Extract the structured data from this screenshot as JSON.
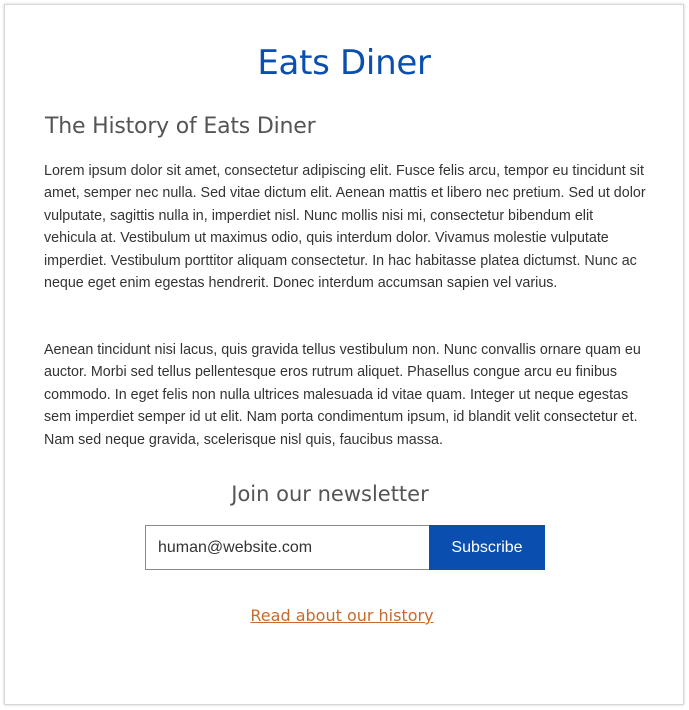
{
  "site": {
    "title": "Eats Diner",
    "brand_color": "#0a4fb0"
  },
  "history": {
    "heading": "The History of Eats Diner",
    "paragraphs": [
      "Lorem ipsum dolor sit amet, consectetur adipiscing elit. Fusce felis arcu, tempor eu tincidunt sit amet, semper nec nulla. Sed vitae dictum elit. Aenean mattis et libero nec pretium. Sed ut dolor vulputate, sagittis nulla in, imperdiet nisl. Nunc mollis nisi mi, consectetur bibendum elit vehicula at. Vestibulum ut maximus odio, quis interdum dolor. Vivamus molestie vulputate imperdiet. Vestibulum porttitor aliquam consectetur. In hac habitasse platea dictumst. Nunc ac neque eget enim egestas hendrerit. Donec interdum accumsan sapien vel varius.",
      "Aenean tincidunt nisi lacus, quis gravida tellus vestibulum non. Nunc convallis ornare quam eu auctor. Morbi sed tellus pellentesque eros rutrum aliquet. Phasellus congue arcu eu finibus commodo. In eget felis non nulla ultrices malesuada id vitae quam. Integer ut neque egestas sem imperdiet semper id ut elit. Nam porta condimentum ipsum, id blandit velit consectetur et. Nam sed neque gravida, scelerisque nisl quis, faucibus massa."
    ]
  },
  "newsletter": {
    "heading": "Join our newsletter",
    "email_value": "human@website.com",
    "subscribe_label": "Subscribe",
    "button_color": "#0a4fb0"
  },
  "footer": {
    "link_text": "Read about our history",
    "link_color": "#c8692e"
  }
}
